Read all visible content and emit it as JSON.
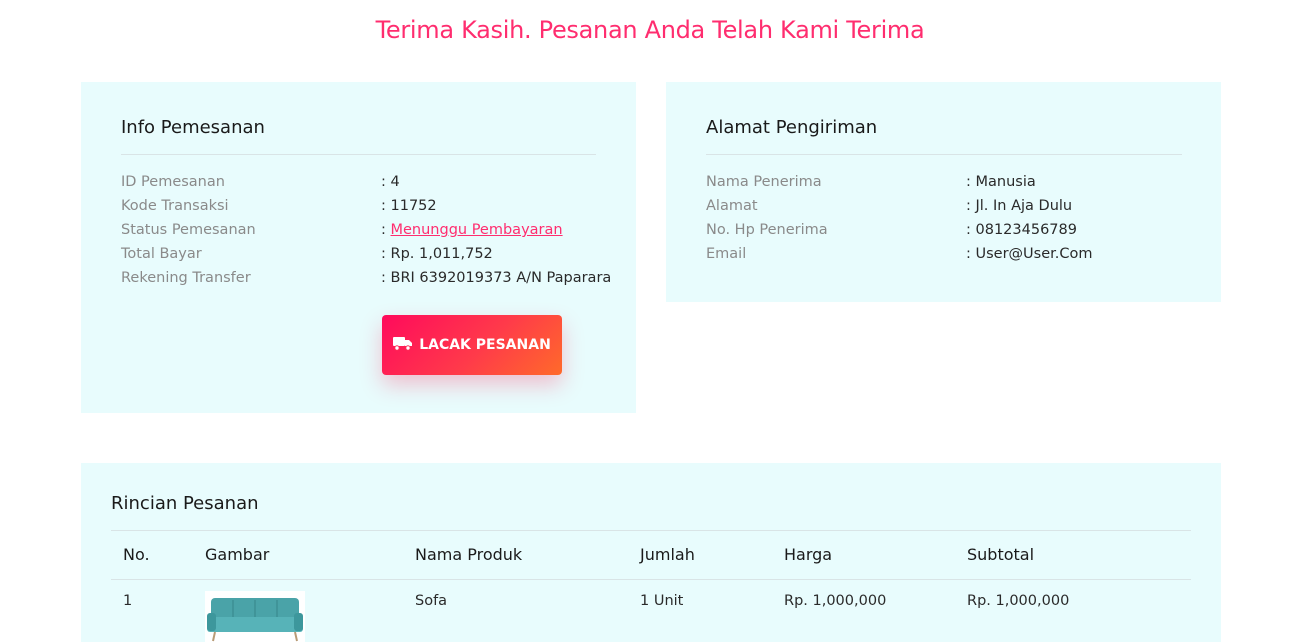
{
  "page_title": "Terima Kasih. Pesanan Anda Telah Kami Terima",
  "info": {
    "title": "Info Pemesanan",
    "rows": [
      {
        "label": "ID Pemesanan",
        "value": ": 4"
      },
      {
        "label": "Kode Transaksi",
        "value": ": 11752"
      },
      {
        "label": "Status Pemesanan",
        "prefix": ": ",
        "link": "Menunggu Pembayaran"
      },
      {
        "label": "Total Bayar",
        "value": ": Rp. 1,011,752"
      },
      {
        "label": "Rekening Transfer",
        "value": ": BRI 6392019373 A/N Paparara"
      }
    ],
    "button_label": "LACAK PESANAN",
    "button_icon": "truck-icon"
  },
  "alamat": {
    "title": "Alamat Pengiriman",
    "rows": [
      {
        "label": "Nama Penerima",
        "value": ": Manusia"
      },
      {
        "label": "Alamat",
        "value": ": Jl. In Aja Dulu"
      },
      {
        "label": "No. Hp Penerima",
        "value": ": 08123456789"
      },
      {
        "label": "Email",
        "value": ": User@User.Com"
      }
    ]
  },
  "rincian": {
    "title": "Rincian Pesanan",
    "columns": [
      "No.",
      "Gambar",
      "Nama Produk",
      "Jumlah",
      "Harga",
      "Subtotal"
    ],
    "rows": [
      {
        "no": "1",
        "image": "sofa-image",
        "nama": "Sofa",
        "jumlah": "1 Unit",
        "harga": "Rp. 1,000,000",
        "subtotal": "Rp. 1,000,000"
      }
    ]
  },
  "colors": {
    "accent": "#ff2d6f",
    "card_bg": "#e8fcfd",
    "button_start": "#ff0a5c",
    "button_end": "#ff6a2a"
  }
}
